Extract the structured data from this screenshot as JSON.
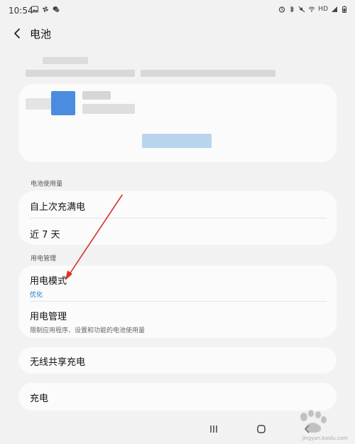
{
  "status_bar": {
    "time": "10:54",
    "left_icons": [
      "image-icon",
      "pinwheel-icon",
      "wechat-icon"
    ],
    "right_icons": [
      "alarm-icon",
      "bluetooth-icon",
      "mute-icon",
      "wifi-icon",
      "hd-signal-icon",
      "battery-icon"
    ],
    "hd_label": "HD"
  },
  "header": {
    "title": "电池",
    "back_icon": "chevron-left-icon"
  },
  "sections": {
    "usage_label": "电池使用量",
    "management_label": "用电管理"
  },
  "usage": {
    "since_full_charge": "自上次充满电",
    "last_7_days": "近 7 天"
  },
  "management": {
    "power_mode_label": "用电模式",
    "power_mode_value": "优化",
    "power_mgmt_label": "用电管理",
    "power_mgmt_desc": "限制应用程序、设置和功能的电池使用量"
  },
  "wireless": {
    "label": "无线共享充电"
  },
  "charge": {
    "label": "充电"
  },
  "navbar": {
    "recent_icon": "recent-apps-icon",
    "home_icon": "home-icon",
    "back_icon": "back-icon"
  },
  "watermark": {
    "text": "jingyan.baidu.com"
  },
  "colors": {
    "background": "#f2f2f2",
    "card": "#fbfbfb",
    "accent_blue": "#1a73c8",
    "annotation_red": "#d9342b"
  }
}
